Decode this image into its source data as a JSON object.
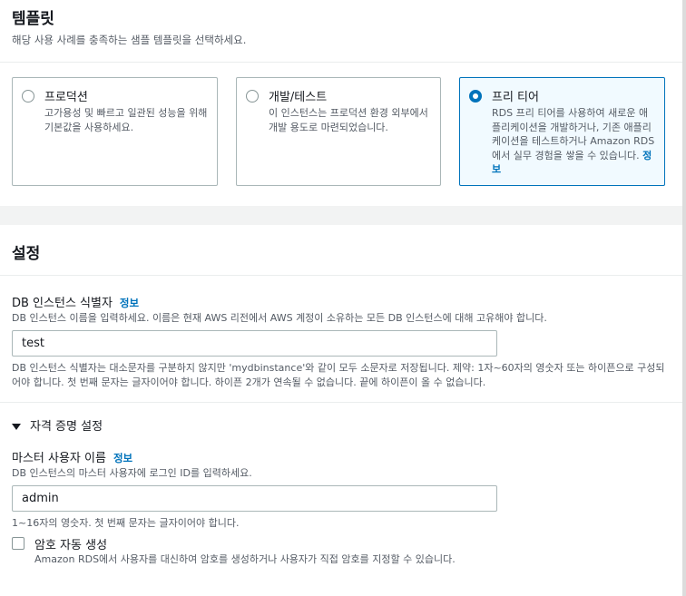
{
  "template": {
    "title": "템플릿",
    "description": "해당 사용 사례를 충족하는 샘플 템플릿을 선택하세요.",
    "options": [
      {
        "label": "프로덕션",
        "description": "고가용성 및 빠르고 일관된 성능을 위해 기본값을 사용하세요.",
        "selected": false
      },
      {
        "label": "개발/테스트",
        "description": "이 인스턴스는 프로덕션 환경 외부에서 개발 용도로 마련되었습니다.",
        "selected": false
      },
      {
        "label": "프리 티어",
        "description": "RDS 프리 티어를 사용하여 새로운 애플리케이션을 개발하거나, 기존 애플리케이션을 테스트하거나 Amazon RDS에서 실무 경험을 쌓을 수 있습니다.",
        "info": "정보",
        "selected": true
      }
    ]
  },
  "settings": {
    "title": "설정",
    "identifier": {
      "label": "DB 인스턴스 식별자",
      "info": "정보",
      "description": "DB 인스턴스 이름을 입력하세요. 이름은 현재 AWS 리전에서 AWS 계정이 소유하는 모든 DB 인스턴스에 대해 고유해야 합니다.",
      "value": "test",
      "constraint": "DB 인스턴스 식별자는 대소문자를 구분하지 않지만 'mydbinstance'와 같이 모두 소문자로 저장됩니다. 제약: 1자~60자의 영숫자 또는 하이픈으로 구성되어야 합니다. 첫 번째 문자는 글자이어야 합니다. 하이픈 2개가 연속될 수 없습니다. 끝에 하이픈이 올 수 없습니다."
    },
    "credentials": {
      "heading": "자격 증명 설정",
      "expanded": true,
      "master_user": {
        "label": "마스터 사용자 이름",
        "info": "정보",
        "description": "DB 인스턴스의 마스터 사용자에 로그인 ID를 입력하세요.",
        "value": "admin",
        "constraint": "1~16자의 영숫자. 첫 번째 문자는 글자이어야 합니다."
      },
      "auto_password": {
        "label": "암호 자동 생성",
        "checked": false,
        "description": "Amazon RDS에서 사용자를 대신하여 암호를 생성하거나 사용자가 직접 암호를 지정할 수 있습니다."
      }
    }
  },
  "colors": {
    "accent": "#0073bb",
    "selected_bg": "#f1faff",
    "border": "#aab7b8",
    "muted_text": "#545b64"
  }
}
